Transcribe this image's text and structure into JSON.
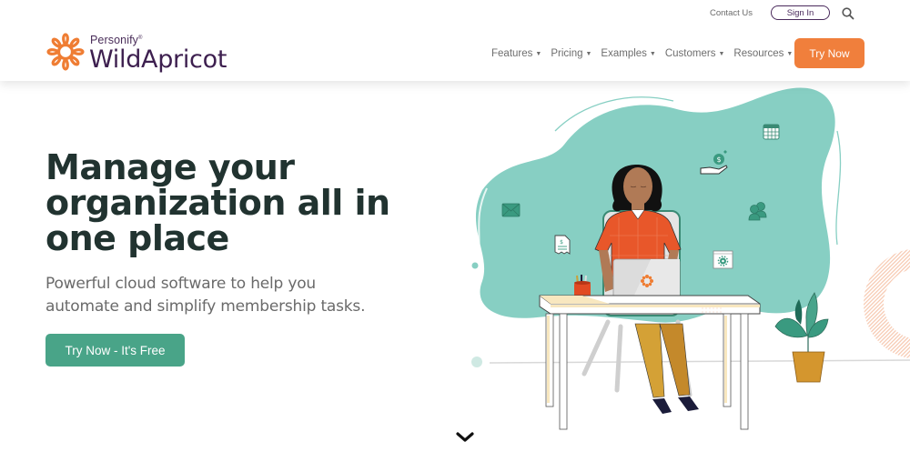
{
  "header": {
    "logo": {
      "brand_small": "Personify",
      "brand_reg": "®",
      "brand_main": "WildApricot",
      "icon": "apricot-flower-logo-icon"
    },
    "topbar": {
      "contact_label": "Contact Us",
      "signin_label": "Sign In",
      "search_icon": "search-icon"
    },
    "nav": {
      "items": [
        {
          "label": "Features",
          "icon": "caret-down-icon"
        },
        {
          "label": "Pricing",
          "icon": "caret-down-icon"
        },
        {
          "label": "Examples",
          "icon": "caret-down-icon"
        },
        {
          "label": "Customers",
          "icon": "caret-down-icon"
        },
        {
          "label": "Resources",
          "icon": "caret-down-icon"
        }
      ],
      "try_now_label": "Try Now"
    }
  },
  "hero": {
    "title": "Manage your organization all in one place",
    "subtitle": "Powerful cloud software to help you automate and simplify membership tasks.",
    "cta_label": "Try Now - It's Free",
    "scroll_icon": "chevron-down-icon"
  },
  "illustration": {
    "subject": "woman-working-at-laptop-desk",
    "floating_icons": [
      "calendar-icon",
      "donation-hand-icon",
      "envelope-icon",
      "members-icon",
      "invoice-icon",
      "settings-window-icon"
    ]
  },
  "colors": {
    "brand_orange": "#f07f3c",
    "brand_purple": "#3d1f4f",
    "cta_green": "#49a488",
    "blob_teal": "#87cfc3",
    "heading_text": "#213330",
    "body_text": "#6a6a6a"
  }
}
